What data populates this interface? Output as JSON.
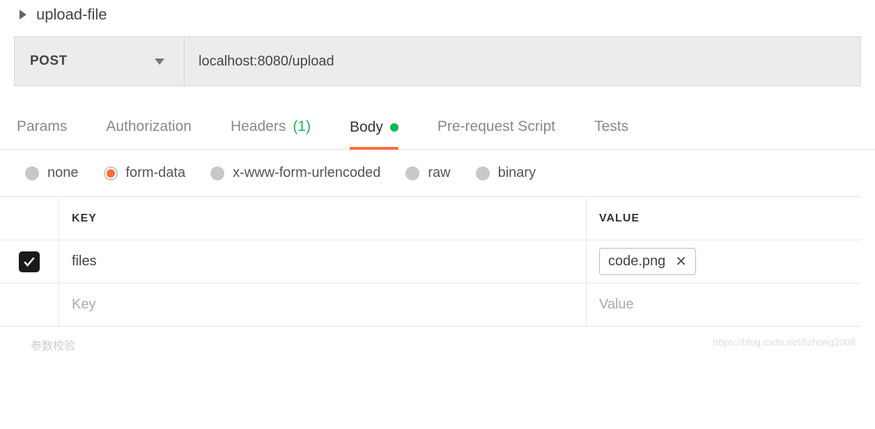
{
  "header": {
    "title": "upload-file"
  },
  "request": {
    "method": "POST",
    "url": "localhost:8080/upload"
  },
  "tabs": {
    "params": "Params",
    "authorization": "Authorization",
    "headers": "Headers",
    "headers_count": "(1)",
    "body": "Body",
    "pre_request": "Pre-request Script",
    "tests": "Tests"
  },
  "body_types": {
    "none": "none",
    "form_data": "form-data",
    "urlencoded": "x-www-form-urlencoded",
    "raw": "raw",
    "binary": "binary"
  },
  "table": {
    "key_header": "KEY",
    "value_header": "VALUE",
    "rows": [
      {
        "checked": true,
        "key": "files",
        "file": "code.png"
      }
    ],
    "key_placeholder": "Key",
    "value_placeholder": "Value"
  },
  "footer": {
    "left": "参数校验",
    "watermark": "https://blog.csdn.net/lizhong2008"
  }
}
